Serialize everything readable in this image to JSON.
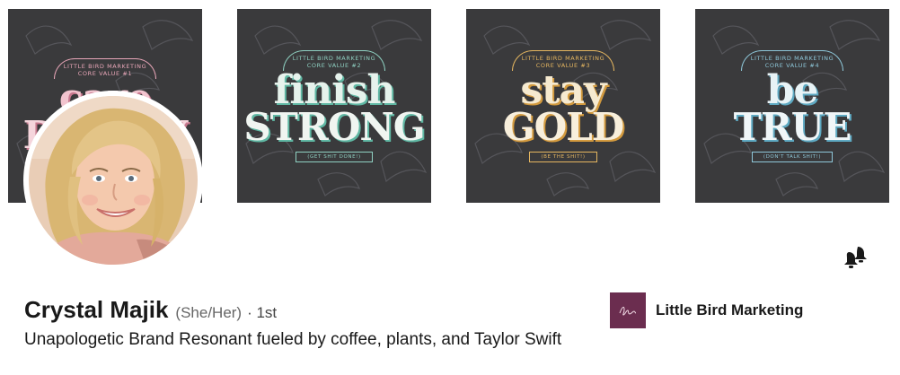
{
  "banner": {
    "tiles": [
      {
        "arch_top": "LITTLE BIRD MARKETING",
        "arch_sub": "CORE VALUE #1",
        "word1": "care",
        "word2": "DEEPLY",
        "ribbon": "",
        "arch_color": "#e8a6b8",
        "word1_color": "#f2c4cf",
        "word2_color": "#f5d5dc",
        "shadow_color": "#c7788e"
      },
      {
        "arch_top": "LITTLE BIRD MARKETING",
        "arch_sub": "CORE VALUE #2",
        "word1": "finish",
        "word2": "STRONG",
        "ribbon": "(GET SHIT DONE!)",
        "arch_color": "#8fd1c2",
        "word1_color": "#e6f2ec",
        "word2_color": "#f0f5f1",
        "shadow_color": "#5fb7a3"
      },
      {
        "arch_top": "LITTLE BIRD MARKETING",
        "arch_sub": "CORE VALUE #3",
        "word1": "stay",
        "word2": "GOLD",
        "ribbon": "(BE THE SHIT!)",
        "arch_color": "#e5b660",
        "word1_color": "#f6ead0",
        "word2_color": "#f8efdc",
        "shadow_color": "#d39a3e"
      },
      {
        "arch_top": "LITTLE BIRD MARKETING",
        "arch_sub": "CORE VALUE #4",
        "word1": "be",
        "word2": "TRUE",
        "ribbon": "(DON'T TALK SHIT!)",
        "arch_color": "#8ec7d9",
        "word1_color": "#e8f3f6",
        "word2_color": "#f0f6f8",
        "shadow_color": "#5ea9c2"
      }
    ]
  },
  "profile": {
    "name": "Crystal Majik",
    "pronouns": "(She/Her)",
    "degree": "· 1st",
    "headline": "Unapologetic Brand Resonant fueled by coffee, plants, and Taylor Swift"
  },
  "company": {
    "name": "Little Bird Marketing",
    "logo_color": "#6b2d4f"
  },
  "icons": {
    "notify": "bell-icon"
  }
}
